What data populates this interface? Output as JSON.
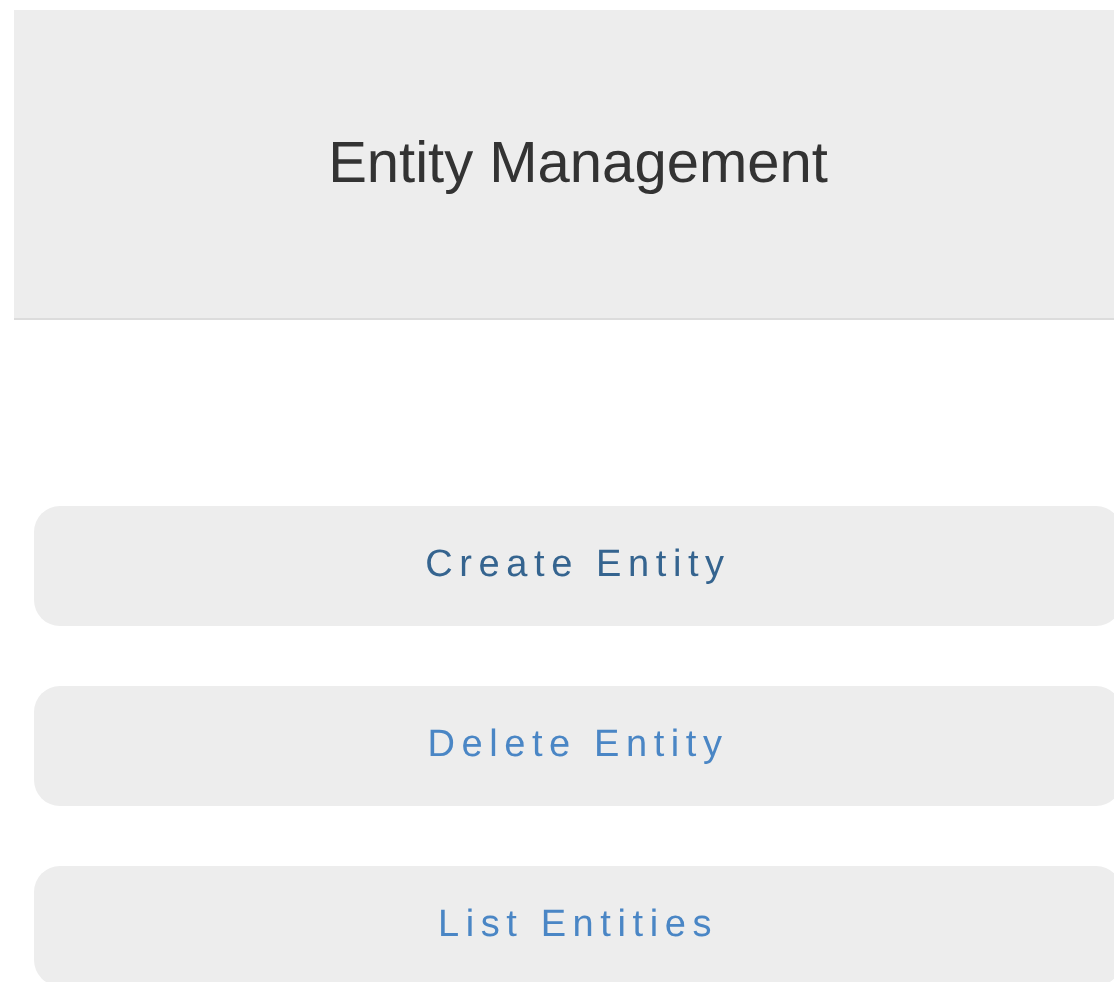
{
  "header": {
    "title": "Entity Management"
  },
  "buttons": [
    {
      "label": "Create Entity",
      "hovered": true
    },
    {
      "label": "Delete Entity",
      "hovered": false
    },
    {
      "label": "List Entities",
      "hovered": false
    }
  ]
}
